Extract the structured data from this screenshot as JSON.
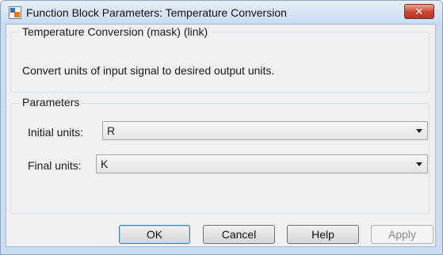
{
  "window": {
    "title": "Function Block Parameters: Temperature Conversion",
    "close_glyph": "✕",
    "icon": "simulink-block-icon"
  },
  "block": {
    "header": "Temperature Conversion (mask) (link)",
    "description": "Convert units of input signal to desired output units."
  },
  "parameters": {
    "legend": "Parameters",
    "initial_units": {
      "label": "Initial units:",
      "value": "R"
    },
    "final_units": {
      "label": "Final units:",
      "value": "K"
    }
  },
  "buttons": {
    "ok": "OK",
    "cancel": "Cancel",
    "help": "Help",
    "apply": "Apply"
  },
  "colors": {
    "titlebar": "#cadcf1",
    "close_button": "#c9452e",
    "dialog_background": "#f0f0f0",
    "default_button_border": "#3c7fb1"
  }
}
